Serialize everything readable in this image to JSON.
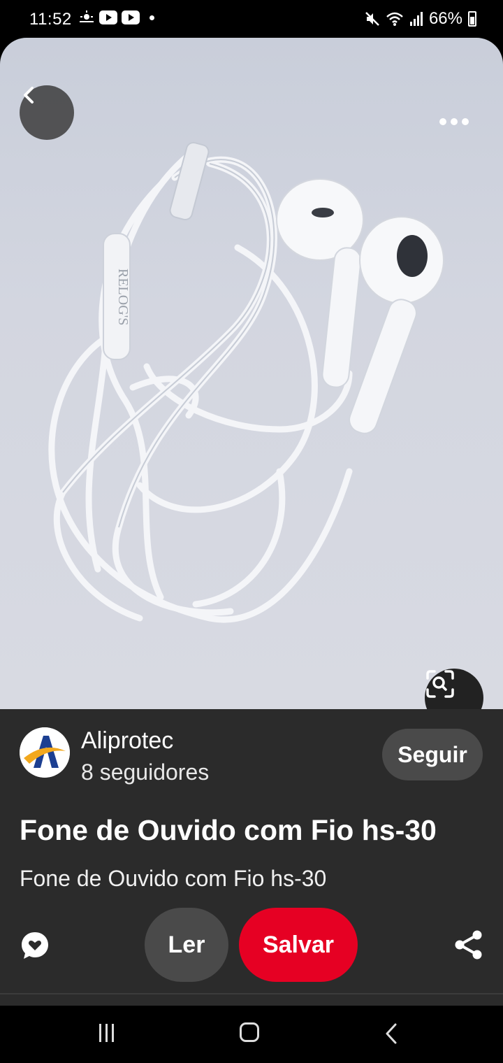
{
  "status_bar": {
    "time": "11:52",
    "battery": "66%",
    "icons": [
      "weather-icon",
      "youtube-icon",
      "youtube-icon",
      "dot-icon",
      "mute-icon",
      "wifi-icon",
      "signal-icon",
      "battery-icon"
    ]
  },
  "image": {
    "product_brand_text": "RELOG'S",
    "alt": "Fone de Ouvido com Fio hs-30"
  },
  "author": {
    "name": "Aliprotec",
    "followers": "8 seguidores",
    "follow_label": "Seguir"
  },
  "pin": {
    "title": "Fone de Ouvido com Fio hs-30",
    "description": "Fone de Ouvido com Fio hs-30"
  },
  "actions": {
    "read_label": "Ler",
    "save_label": "Salvar"
  },
  "colors": {
    "save": "#e60023",
    "panel": "#2b2b2b",
    "pill": "#4a4a4a"
  }
}
